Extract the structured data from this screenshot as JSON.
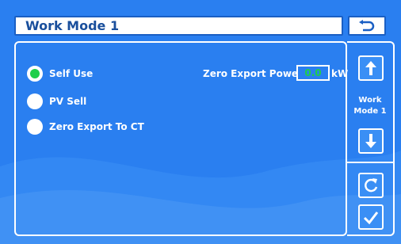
{
  "header": {
    "title": "Work Mode 1",
    "back_icon": "return-arrow-icon"
  },
  "options": [
    {
      "label": "Self Use",
      "selected": true
    },
    {
      "label": "PV Sell",
      "selected": false
    },
    {
      "label": "Zero Export To CT",
      "selected": false
    }
  ],
  "zero_export": {
    "label": "Zero Export Power:",
    "value": "0.0",
    "unit": "kW"
  },
  "side": {
    "mode_line1": "Work",
    "mode_line2": "Mode 1",
    "icons": [
      "arrow-up-icon",
      "arrow-down-icon",
      "refresh-icon",
      "check-icon"
    ]
  },
  "colors": {
    "background": "#2a7ff0",
    "selected_dot": "#1fcf4a",
    "value_text": "#1fcf4a",
    "title_text": "#1a4f9c"
  }
}
